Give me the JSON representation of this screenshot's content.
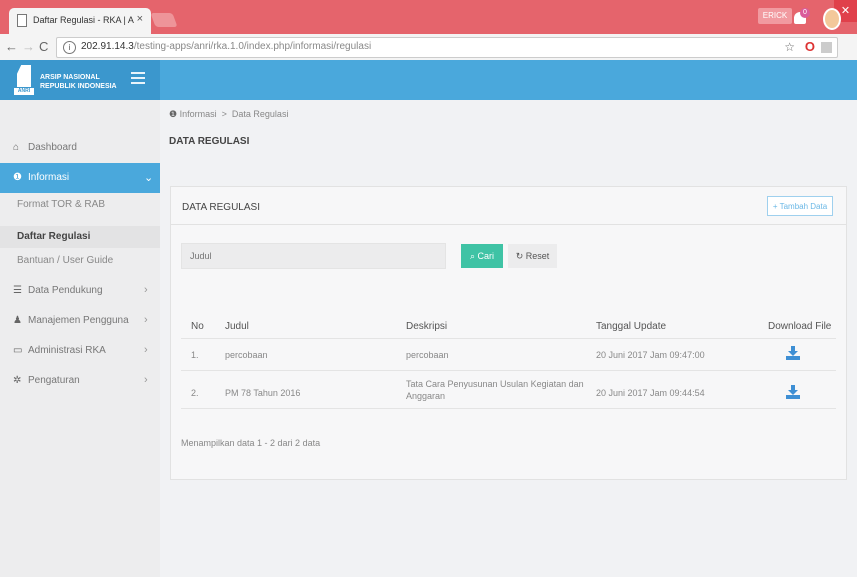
{
  "browser": {
    "tab_title": "Daftar Regulasi - RKA | A",
    "tab_close": "×",
    "url_host": "202.91.14.3",
    "url_path": "/testing-apps/anri/rka.1.0/index.php/informasi/regulasi",
    "user_badge": "ERICK",
    "window_controls": "– ☐"
  },
  "app": {
    "logo_line1": "ARSIP NASIONAL",
    "logo_line2": "REPUBLIK INDONESIA",
    "logo_badge": "ANRI",
    "notification_count": "0",
    "accent_color": "#4aa8dc",
    "success_color": "#3fc3a5"
  },
  "sidebar": {
    "items": [
      {
        "label": "Dashboard",
        "icon": "home-icon"
      },
      {
        "label": "Informasi",
        "icon": "info-icon"
      },
      {
        "label": "Data Pendukung",
        "icon": "list-icon"
      },
      {
        "label": "Manajemen Pengguna",
        "icon": "user-icon"
      },
      {
        "label": "Administrasi RKA",
        "icon": "folder-icon"
      },
      {
        "label": "Pengaturan",
        "icon": "gear-icon"
      }
    ],
    "sub_items": [
      {
        "label": "Format TOR & RAB"
      },
      {
        "label": "Daftar Regulasi"
      },
      {
        "label": "Bantuan / User Guide"
      }
    ]
  },
  "breadcrumb": {
    "parent": "Informasi",
    "sep": ">",
    "current": "Data Regulasi"
  },
  "page": {
    "title": "DATA REGULASI"
  },
  "panel": {
    "title": "DATA REGULASI",
    "add_button": "+ Tambah Data",
    "search_placeholder": "Judul",
    "search_button": "Cari",
    "reset_button": "Reset"
  },
  "table": {
    "headers": [
      "No",
      "Judul",
      "Deskripsi",
      "Tanggal Update",
      "Download File"
    ],
    "rows": [
      {
        "no": "1.",
        "judul": "percobaan",
        "deskripsi": "percobaan",
        "tanggal": "20 Juni 2017 Jam 09:47:00"
      },
      {
        "no": "2.",
        "judul": "PM 78 Tahun 2016",
        "deskripsi": "Tata Cara Penyusunan Usulan Kegiatan dan Anggaran",
        "tanggal": "20 Juni 2017 Jam 09:44:54"
      }
    ],
    "footer": "Menampilkan data 1 - 2 dari 2 data"
  }
}
